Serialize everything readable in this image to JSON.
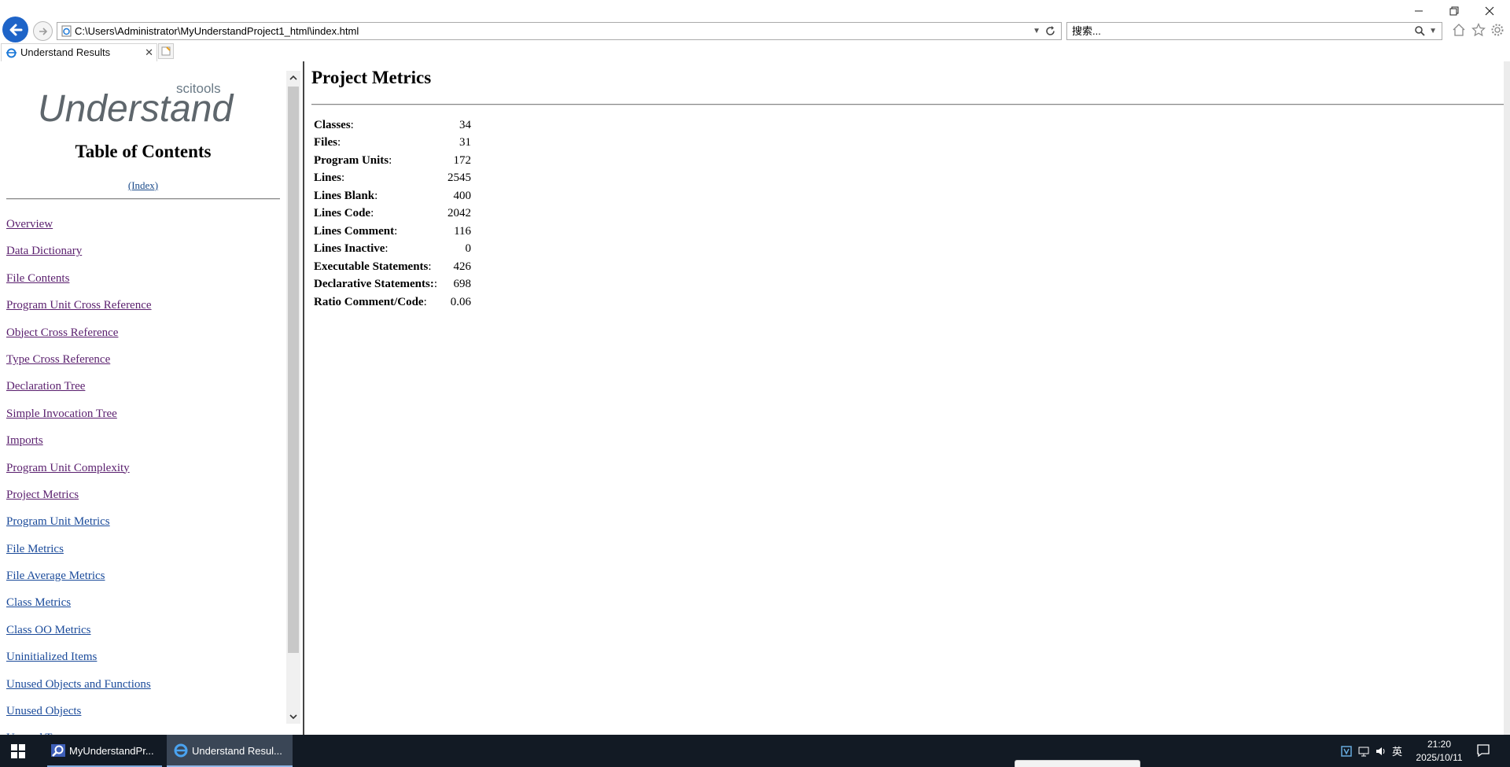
{
  "browser": {
    "address": "C:\\Users\\Administrator\\MyUnderstandProject1_html\\index.html",
    "search_placeholder": "搜索...",
    "tab_title": "Understand Results"
  },
  "sidebar": {
    "logo_brand": "scitools",
    "logo_name": "Understand",
    "toc_title": "Table of Contents",
    "index_link": "(Index)",
    "items": [
      {
        "label": "Overview",
        "visited": true
      },
      {
        "label": "Data Dictionary",
        "visited": true
      },
      {
        "label": "File Contents",
        "visited": true
      },
      {
        "label": "Program Unit Cross Reference",
        "visited": true
      },
      {
        "label": "Object Cross Reference",
        "visited": true
      },
      {
        "label": "Type Cross Reference",
        "visited": true
      },
      {
        "label": "Declaration Tree",
        "visited": true
      },
      {
        "label": "Simple Invocation Tree",
        "visited": true
      },
      {
        "label": "Imports",
        "visited": true
      },
      {
        "label": "Program Unit Complexity",
        "visited": true
      },
      {
        "label": "Project Metrics",
        "visited": true
      },
      {
        "label": "Program Unit Metrics",
        "visited": false
      },
      {
        "label": "File Metrics",
        "visited": false
      },
      {
        "label": "File Average Metrics",
        "visited": false
      },
      {
        "label": "Class Metrics",
        "visited": false
      },
      {
        "label": "Class OO Metrics",
        "visited": false
      },
      {
        "label": "Uninitialized Items",
        "visited": false
      },
      {
        "label": "Unused Objects and Functions",
        "visited": false
      },
      {
        "label": "Unused Objects",
        "visited": false
      },
      {
        "label": "Unused Types",
        "visited": false
      }
    ]
  },
  "main": {
    "title": "Project Metrics",
    "metrics": [
      {
        "label": "Classes",
        "value": "34"
      },
      {
        "label": "Files",
        "value": "31"
      },
      {
        "label": "Program Units",
        "value": "172"
      },
      {
        "label": "Lines",
        "value": "2545"
      },
      {
        "label": "Lines Blank",
        "value": "400"
      },
      {
        "label": "Lines Code",
        "value": "2042"
      },
      {
        "label": "Lines Comment",
        "value": "116"
      },
      {
        "label": "Lines Inactive",
        "value": "0"
      },
      {
        "label": "Executable Statements",
        "value": "426"
      },
      {
        "label": "Declarative Statements:",
        "value": "698"
      },
      {
        "label": "Ratio Comment/Code",
        "value": "0.06"
      }
    ]
  },
  "taskbar": {
    "items": [
      {
        "label": "MyUnderstandPr..."
      },
      {
        "label": "Understand Resul..."
      }
    ],
    "ime": "英",
    "time": "21:20",
    "date": "2025/10/11"
  }
}
